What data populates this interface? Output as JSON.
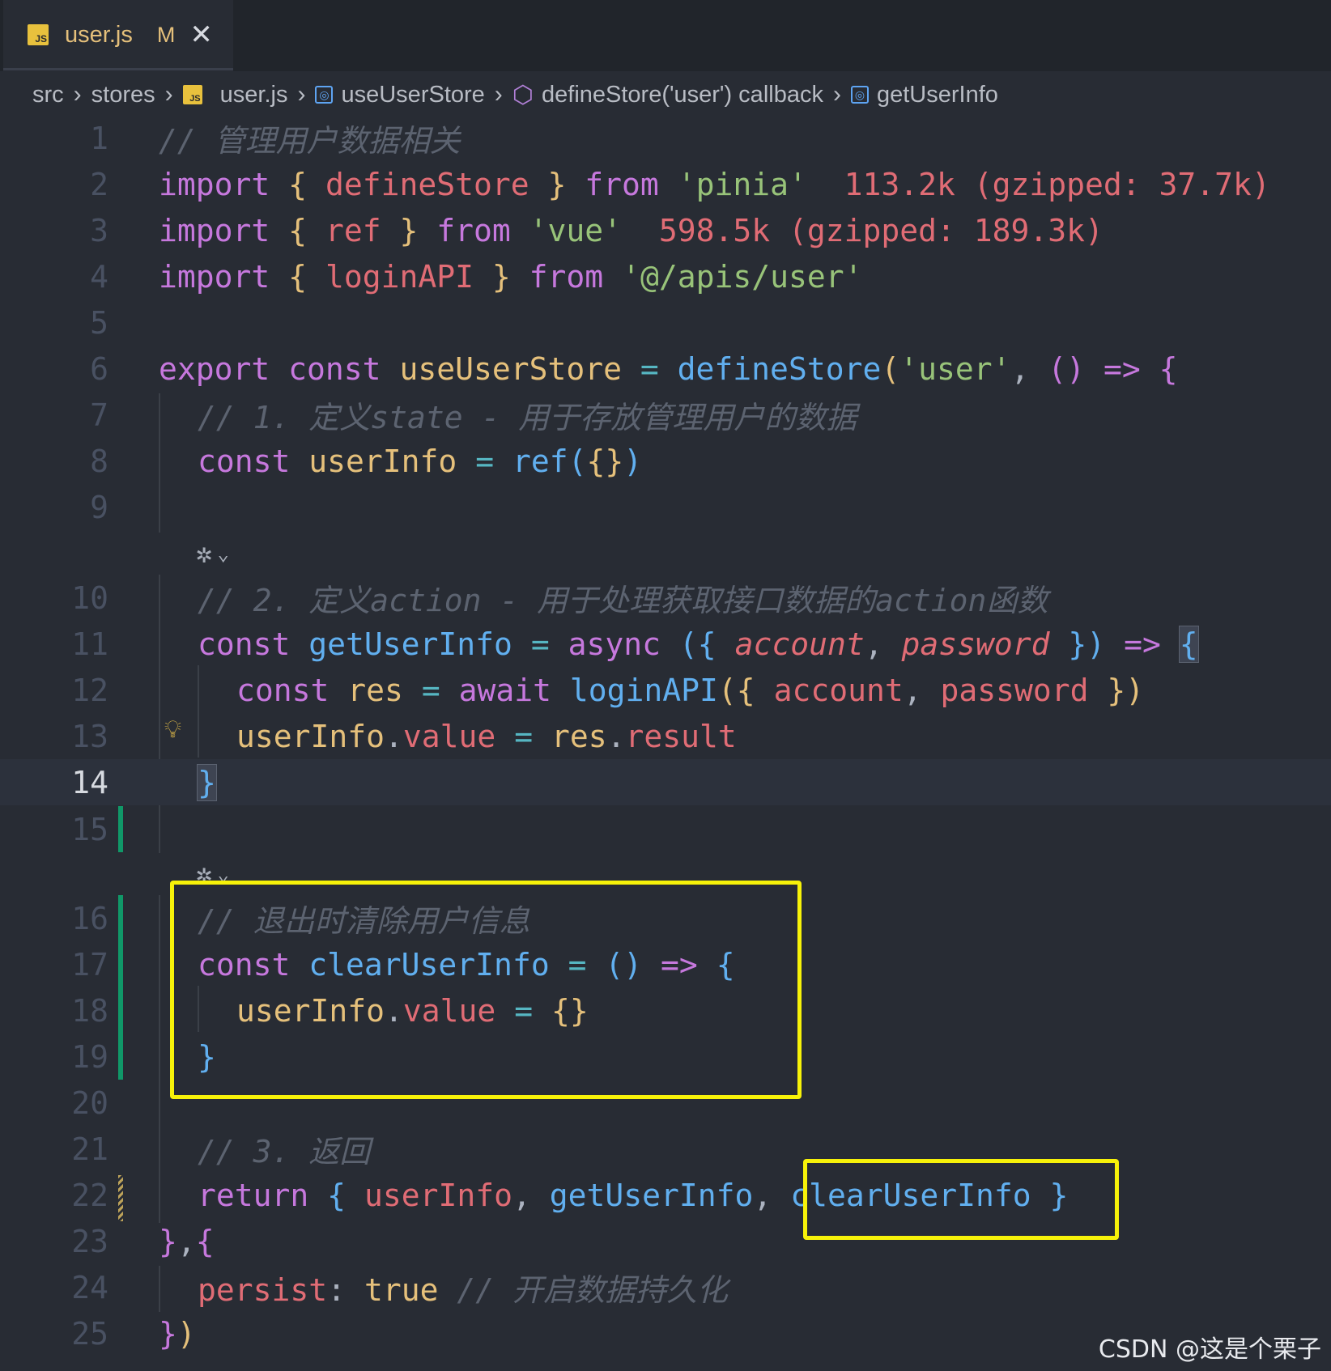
{
  "tab": {
    "icon": "javascript-file-icon",
    "badge": "JS",
    "filename": "user.js",
    "modified": "M",
    "close": "✕"
  },
  "breadcrumb": {
    "items": [
      "src",
      "stores",
      "user.js",
      "useUserStore",
      "defineStore('user') callback",
      "getUserInfo"
    ],
    "separator": "›",
    "badge": "JS"
  },
  "code": {
    "line_numbers": [
      "1",
      "2",
      "3",
      "4",
      "5",
      "6",
      "7",
      "8",
      "9",
      "10",
      "11",
      "12",
      "13",
      "14",
      "15",
      "16",
      "17",
      "18",
      "19",
      "20",
      "21",
      "22",
      "23",
      "24",
      "25"
    ],
    "active_line": "14",
    "l1_comment": "// 管理用户数据相关",
    "l2": {
      "import": "import",
      "open": "{",
      "name": "defineStore",
      "close": "}",
      "from": "from",
      "mod": "'pinia'",
      "size": "113.2k (gzipped: 37.7k)"
    },
    "l3": {
      "import": "import",
      "open": "{",
      "name": "ref",
      "close": "}",
      "from": "from",
      "mod": "'vue'",
      "size": "598.5k (gzipped: 189.3k)"
    },
    "l4": {
      "import": "import",
      "open": "{",
      "name": "loginAPI",
      "close": "}",
      "from": "from",
      "mod": "'@/apis/user'"
    },
    "l6": {
      "export": "export",
      "const": "const",
      "name": "useUserStore",
      "eq": "=",
      "fn": "defineStore",
      "p1": "(",
      "arg": "'user'",
      "comma": ",",
      "p2": "()",
      "arrow": "=>",
      "brace": "{"
    },
    "l7_comment": "// 1. 定义state - 用于存放管理用户的数据",
    "l8": {
      "const": "const",
      "name": "userInfo",
      "eq": "=",
      "fn": "ref",
      "p1": "(",
      "inner": "{}",
      "p2": ")"
    },
    "l10_comment": "// 2. 定义action - 用于处理获取接口数据的action函数",
    "l11": {
      "const": "const",
      "name": "getUserInfo",
      "eq": "=",
      "async": "async",
      "p1": "({",
      "a1": "account",
      "comma": ",",
      "a2": "password",
      "p2": "})",
      "arrow": "=>",
      "brace": "{"
    },
    "l12": {
      "const": "const",
      "name": "res",
      "eq": "=",
      "await": "await",
      "fn": "loginAPI",
      "p1": "({",
      "a1": "account",
      "comma": ",",
      "a2": "password",
      "p2": "})"
    },
    "l13": {
      "obj": "userInfo",
      "dot": ".",
      "prop": "value",
      "eq": "=",
      "obj2": "res",
      "dot2": ".",
      "prop2": "result"
    },
    "l14": {
      "brace": "}"
    },
    "l16_comment": "// 退出时清除用户信息",
    "l17": {
      "const": "const",
      "name": "clearUserInfo",
      "eq": "=",
      "p": "()",
      "arrow": "=>",
      "brace": "{"
    },
    "l18": {
      "obj": "userInfo",
      "dot": ".",
      "prop": "value",
      "eq": "=",
      "val": "{}"
    },
    "l19": {
      "brace": "}"
    },
    "l21_comment": "// 3. 返回",
    "l22": {
      "ret": "return",
      "open": "{",
      "a": "userInfo",
      "c1": ",",
      "b": "getUserInfo",
      "c2": ",",
      "c": "clearUserInfo",
      "close": "}"
    },
    "l23": {
      "a": "}",
      "b": ",",
      "c": "{"
    },
    "l24": {
      "key": "persist",
      "colon": ":",
      "val": "true",
      "comment": "// 开启数据持久化"
    },
    "l25": {
      "a": "}",
      "b": ")"
    }
  },
  "codelens": {
    "icon": "tongyi-lingma-icon",
    "chevron": "⌄"
  },
  "lightbulb": "lightbulb-icon",
  "watermark": "CSDN @这是个栗子",
  "colors": {
    "background": "#282c34",
    "keyword": "#c678dd",
    "variable": "#e06c75",
    "function": "#61afef",
    "string": "#98c379",
    "highlight_box": "#f7f209",
    "git_added": "#109868"
  }
}
